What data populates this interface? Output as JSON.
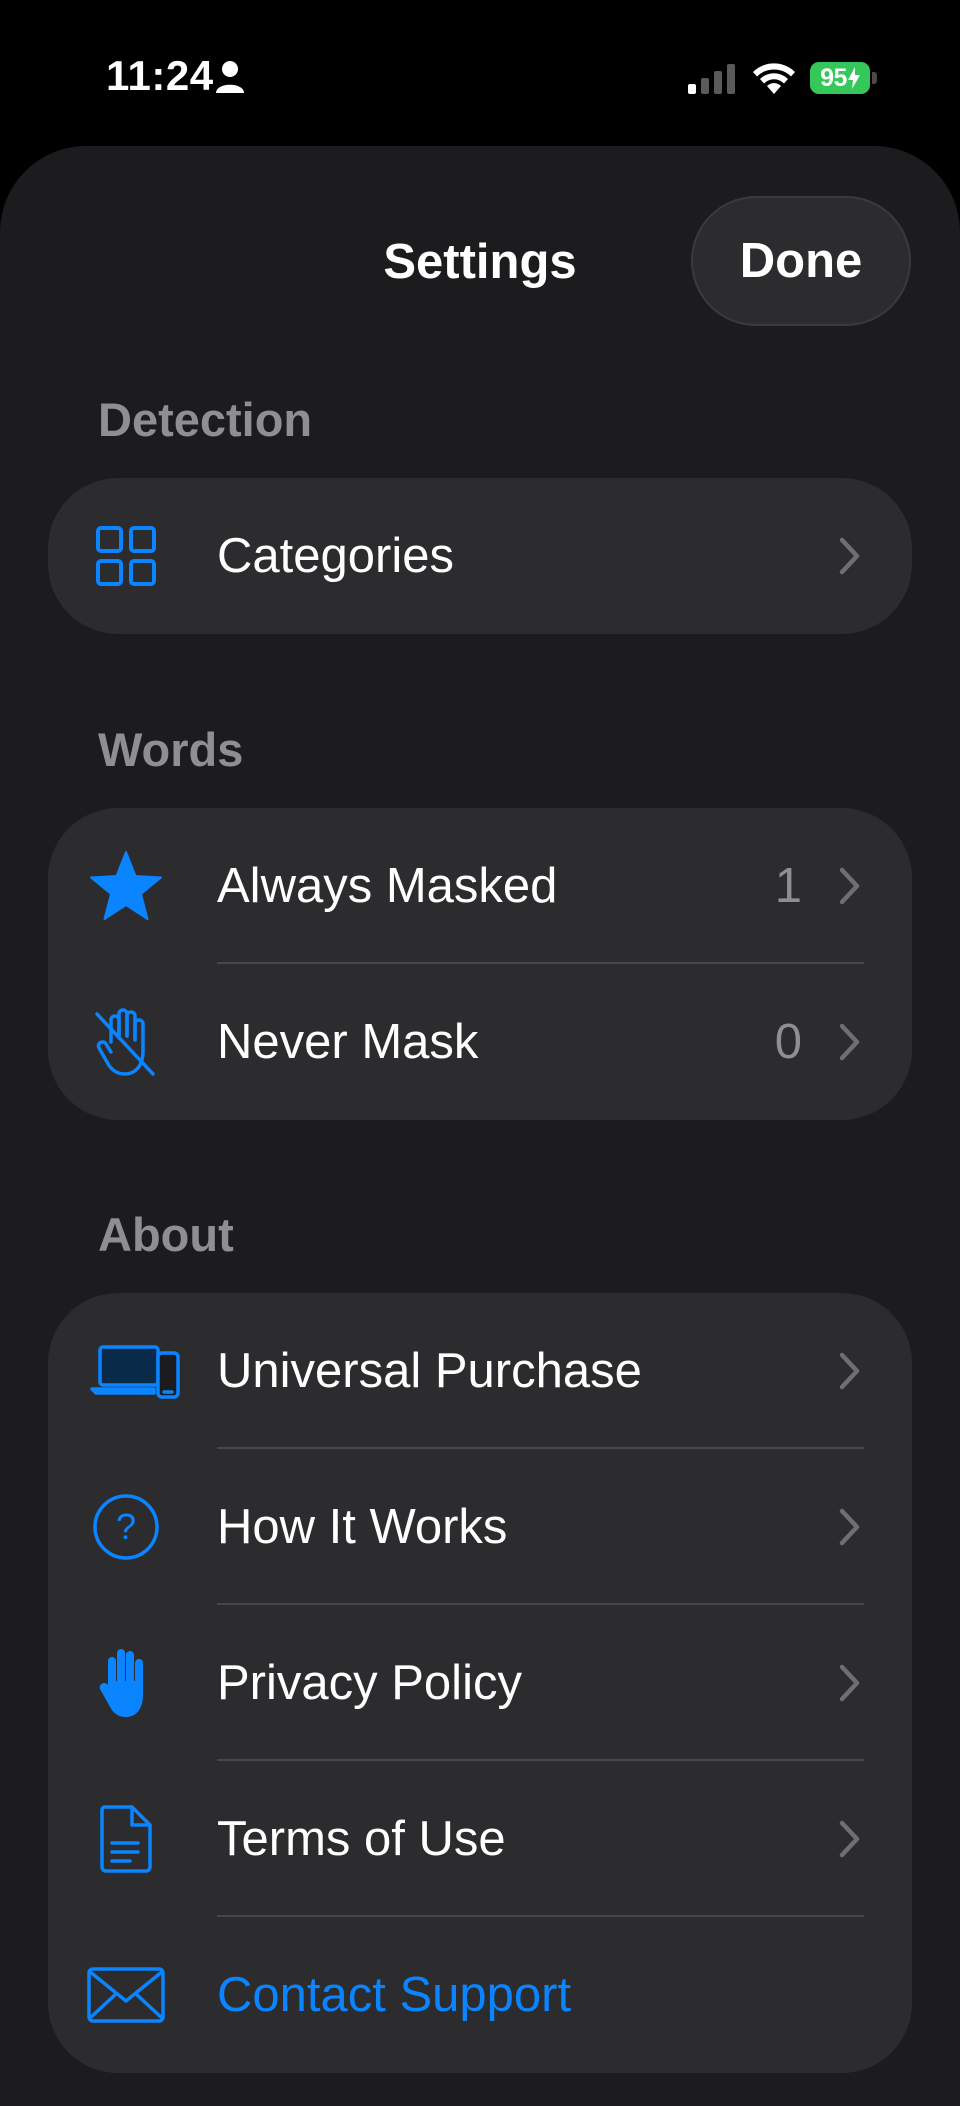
{
  "status_bar": {
    "time": "11:24",
    "battery": "95"
  },
  "nav": {
    "title": "Settings",
    "done_label": "Done"
  },
  "colors": {
    "accent": "#0a84ff",
    "background": "#000000",
    "sheet": "#1c1c1e",
    "group": "#2c2c2e",
    "battery": "#34c759",
    "secondary_text": "#8e8e93"
  },
  "sections": {
    "detection": {
      "header": "Detection",
      "items": [
        {
          "label": "Categories",
          "icon": "grid-icon"
        }
      ]
    },
    "words": {
      "header": "Words",
      "items": [
        {
          "label": "Always Masked",
          "value": "1",
          "icon": "star-icon"
        },
        {
          "label": "Never Mask",
          "value": "0",
          "icon": "hand-slash-icon"
        }
      ]
    },
    "about": {
      "header": "About",
      "items": [
        {
          "label": "Universal Purchase",
          "icon": "laptop-phone-icon"
        },
        {
          "label": "How It Works",
          "icon": "question-circle-icon"
        },
        {
          "label": "Privacy Policy",
          "icon": "hand-raised-icon"
        },
        {
          "label": "Terms of Use",
          "icon": "document-icon"
        },
        {
          "label": "Contact Support",
          "icon": "envelope-icon"
        }
      ]
    }
  }
}
